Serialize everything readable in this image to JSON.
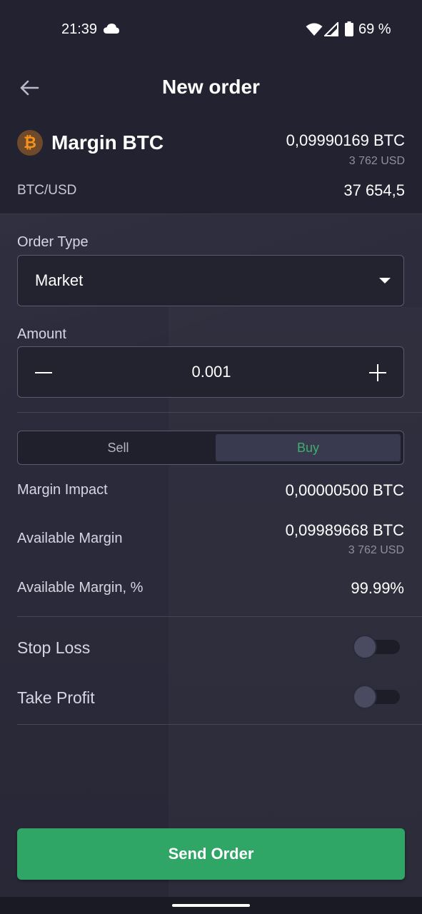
{
  "status_bar": {
    "time": "21:39",
    "battery": "69 %"
  },
  "header": {
    "title": "New order"
  },
  "account": {
    "coin_symbol": "₿",
    "name": "Margin BTC",
    "balance": "0,09990169 BTC",
    "balance_usd": "3 762 USD"
  },
  "pair": {
    "name": "BTC/USD",
    "price": "37 654,5"
  },
  "order_type": {
    "label": "Order Type",
    "value": "Market"
  },
  "amount": {
    "label": "Amount",
    "value": "0.001"
  },
  "side": {
    "sell_label": "Sell",
    "buy_label": "Buy",
    "selected": "Buy"
  },
  "info": {
    "margin_impact_label": "Margin Impact",
    "margin_impact_value": "0,00000500 BTC",
    "available_margin_label": "Available Margin",
    "available_margin_value": "0,09989668 BTC",
    "available_margin_usd": "3 762 USD",
    "available_margin_pct_label": "Available Margin, %",
    "available_margin_pct_value": "99.99%"
  },
  "toggles": {
    "stop_loss_label": "Stop Loss",
    "stop_loss_on": false,
    "take_profit_label": "Take Profit",
    "take_profit_on": false
  },
  "actions": {
    "send_label": "Send Order"
  },
  "colors": {
    "accent_green": "#2fa566",
    "buy_text": "#3fae6a",
    "background": "#2b2b3b"
  }
}
